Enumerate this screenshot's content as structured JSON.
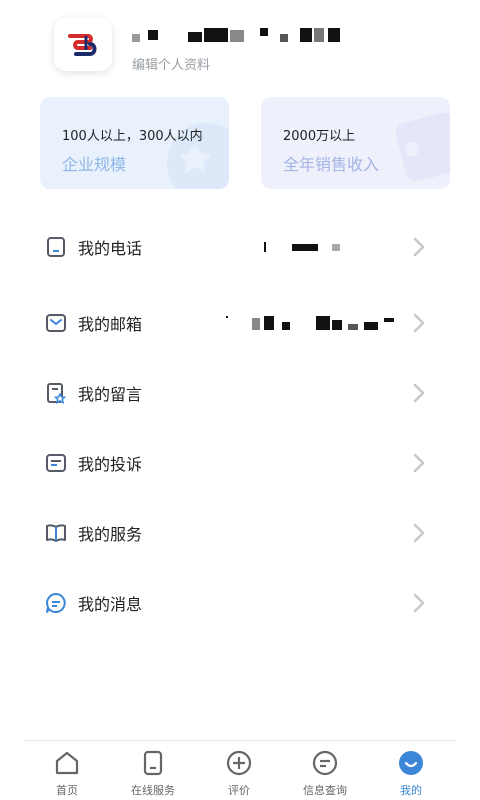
{
  "profile": {
    "company_name": "",
    "edit_label": "编辑个人资料"
  },
  "cards": [
    {
      "value": "100人以上，300人以内",
      "label": "企业规模"
    },
    {
      "value": "2000万以上",
      "label": "全年销售收入"
    }
  ],
  "menu": [
    {
      "label": "我的电话",
      "icon": "phone-icon"
    },
    {
      "label": "我的邮箱",
      "icon": "mail-icon"
    },
    {
      "label": "我的留言",
      "icon": "message-star-icon"
    },
    {
      "label": "我的投诉",
      "icon": "complaint-icon"
    },
    {
      "label": "我的服务",
      "icon": "book-icon"
    },
    {
      "label": "我的消息",
      "icon": "chat-icon"
    }
  ],
  "tabs": [
    {
      "label": "首页",
      "icon": "home-icon",
      "active": false
    },
    {
      "label": "在线服务",
      "icon": "phone-service-icon",
      "active": false
    },
    {
      "label": "评价",
      "icon": "plus-circle-icon",
      "active": false
    },
    {
      "label": "信息查询",
      "icon": "message-circle-icon",
      "active": false
    },
    {
      "label": "我的",
      "icon": "smile-icon",
      "active": true
    }
  ],
  "colors": {
    "accent": "#3b86d6",
    "card_scale_bg": "#e8f1fc",
    "card_income_bg": "#eef0fb"
  }
}
